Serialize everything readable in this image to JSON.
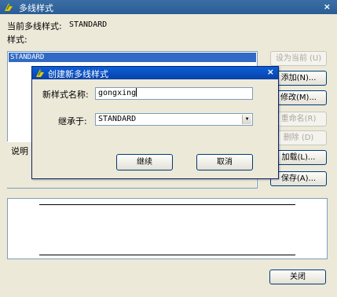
{
  "window": {
    "title": "多线样式",
    "close_glyph": "×",
    "current_style_label": "当前多线样式:",
    "current_style_value": "STANDARD",
    "styles_label": "样式:",
    "styles_list": [
      "STANDARD"
    ],
    "description_label": "说明",
    "buttons": {
      "set_current": "设为当前 (U)",
      "add": "添加(N)...",
      "modify": "修改(M)...",
      "rename": "重命名(R)",
      "delete": "删除 (D)",
      "load": "加载(L)...",
      "save": "保存(A)...",
      "close": "关闭"
    }
  },
  "dialog": {
    "title": "创建新多线样式",
    "close_glyph": "×",
    "name_label": "新样式名称:",
    "name_value": "gongxing",
    "base_label": "继承于:",
    "base_value": "STANDARD",
    "continue_label": "继续",
    "cancel_label": "取消"
  },
  "icons": {
    "app_icon": "autocad-icon",
    "combo_arrow": "▼"
  },
  "colors": {
    "title_bar": "#3a6ea5",
    "dialog_title_bar": "#0a5fd8",
    "selection": "#316ac5",
    "background": "#ece9d8"
  }
}
